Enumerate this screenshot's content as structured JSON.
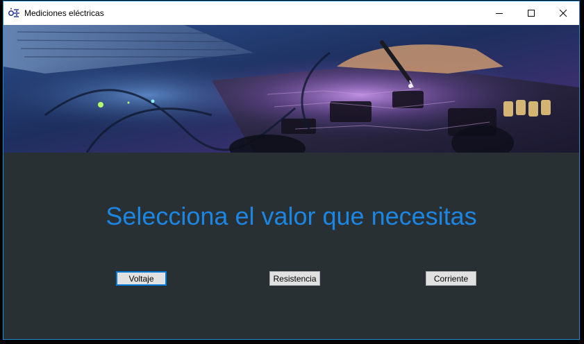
{
  "window": {
    "title": "Mediciones eléctricas",
    "icon": "app-circuit-icon",
    "controls": [
      "minimize-icon",
      "maximize-icon",
      "close-icon"
    ]
  },
  "banner": {
    "image": "electronics-circuit-board-photo"
  },
  "main": {
    "headline": "Selecciona el valor que necesitas",
    "buttons": {
      "voltage": "Voltaje",
      "resistance": "Resistencia",
      "current": "Corriente"
    }
  },
  "colors": {
    "background": "#293034",
    "headline": "#1b86e3",
    "accent": "#0078d7",
    "window_border": "#1a8fd8"
  }
}
